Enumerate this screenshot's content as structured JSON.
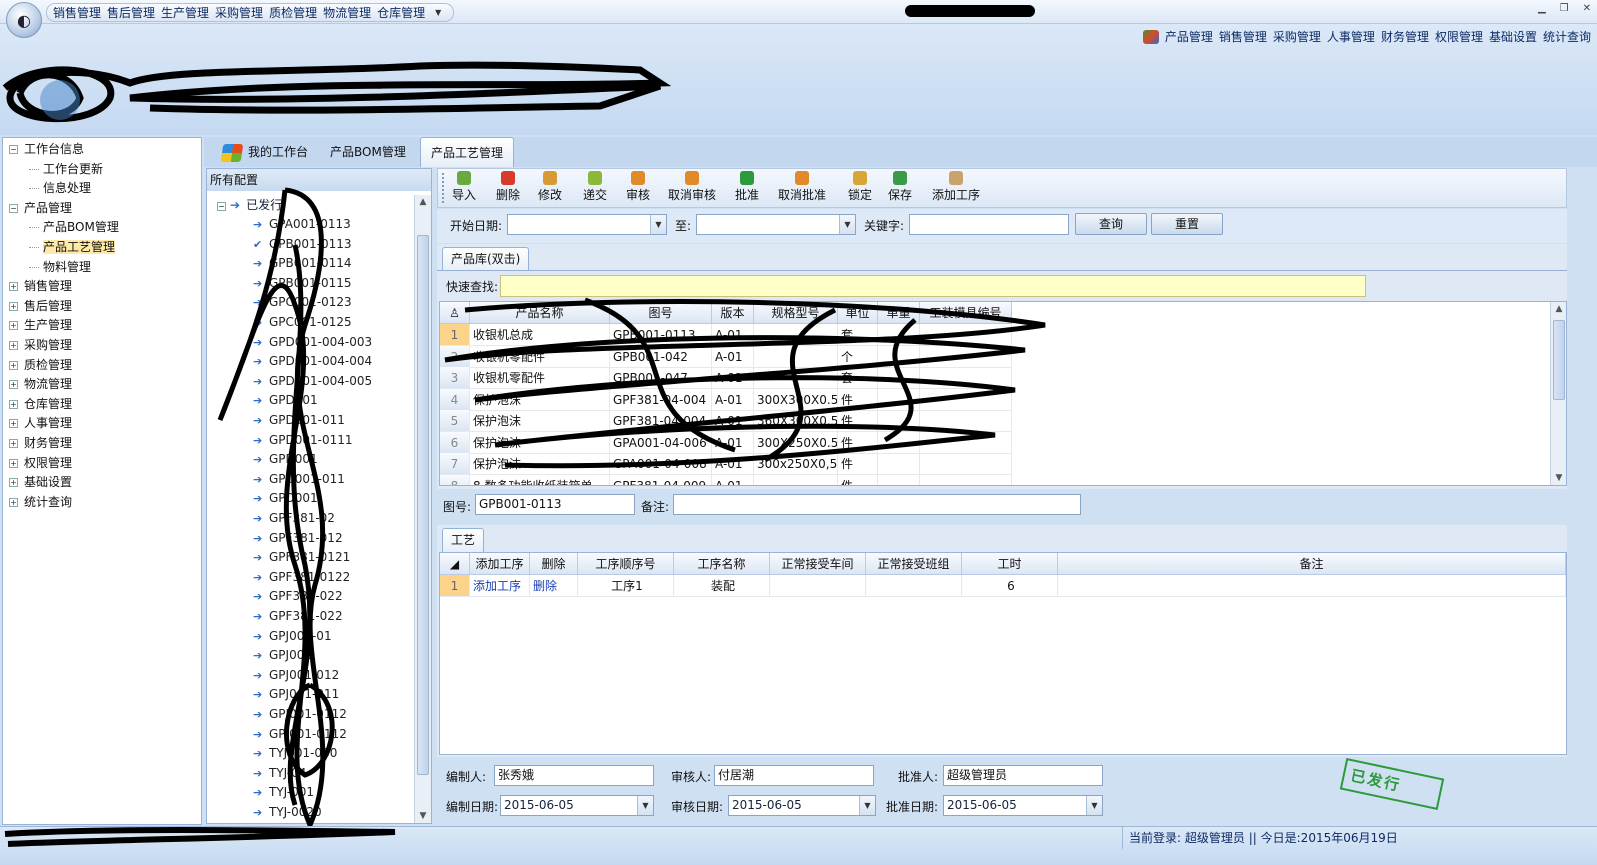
{
  "quick_menu": [
    "销售管理",
    "售后管理",
    "生产管理",
    "采购管理",
    "质检管理",
    "物流管理",
    "仓库管理"
  ],
  "top_nav": [
    "产品管理",
    "销售管理",
    "采购管理",
    "人事管理",
    "财务管理",
    "权限管理",
    "基础设置",
    "统计查询"
  ],
  "left_tree": {
    "items": [
      {
        "label": "工作台信息",
        "toggle": "−",
        "level": 0
      },
      {
        "label": "工作台更新",
        "level": 1
      },
      {
        "label": "信息处理",
        "level": 1
      },
      {
        "label": "产品管理",
        "toggle": "−",
        "level": 0
      },
      {
        "label": "产品BOM管理",
        "level": 1
      },
      {
        "label": "产品工艺管理",
        "level": 1,
        "selected": true
      },
      {
        "label": "物料管理",
        "level": 1
      },
      {
        "label": "销售管理",
        "toggle": "+",
        "level": 0
      },
      {
        "label": "售后管理",
        "toggle": "+",
        "level": 0
      },
      {
        "label": "生产管理",
        "toggle": "+",
        "level": 0
      },
      {
        "label": "采购管理",
        "toggle": "+",
        "level": 0
      },
      {
        "label": "质检管理",
        "toggle": "+",
        "level": 0
      },
      {
        "label": "物流管理",
        "toggle": "+",
        "level": 0
      },
      {
        "label": "仓库管理",
        "toggle": "+",
        "level": 0
      },
      {
        "label": "人事管理",
        "toggle": "+",
        "level": 0
      },
      {
        "label": "财务管理",
        "toggle": "+",
        "level": 0
      },
      {
        "label": "权限管理",
        "toggle": "+",
        "level": 0
      },
      {
        "label": "基础设置",
        "toggle": "+",
        "level": 0
      },
      {
        "label": "统计查询",
        "toggle": "+",
        "level": 0
      }
    ]
  },
  "tabs": [
    {
      "label": "我的工作台"
    },
    {
      "label": "产品BOM管理"
    },
    {
      "label": "产品工艺管理",
      "active": true
    }
  ],
  "config_panel": {
    "header": "所有配置",
    "root_label": "已发行",
    "items": [
      "GPA001-0113",
      "GPB001-0113",
      "GPB001-0114",
      "GPB001-0115",
      "GPC001-0123",
      "GPC001-0125",
      "GPD001-004-003",
      "GPD001-004-004",
      "GPD001-004-005",
      "GPD001",
      "GPD001-011",
      "GPD001-0111",
      "GPD001",
      "GPD001-011",
      "GPD001",
      "GPF381-02",
      "GPF381-012",
      "GPF381-0121",
      "GPF381-0122",
      "GPF381-022",
      "GPF381-022",
      "GPJ001-01",
      "GPJ001",
      "GPJ001-012",
      "GPJ001-011",
      "GPJ001-0112",
      "GPJ001-0112",
      "TYJ001-030",
      "TYJ-04",
      "TYJ-001",
      "TYJ-0020"
    ]
  },
  "toolbar": [
    {
      "label": "导入",
      "icon": "import-icon",
      "color": "#6aa840"
    },
    {
      "label": "删除",
      "icon": "delete-icon",
      "color": "#d83a2b"
    },
    {
      "label": "修改",
      "icon": "edit-icon",
      "color": "#d89a36"
    },
    {
      "label": "递交",
      "icon": "submit-icon",
      "color": "#8cb83a"
    },
    {
      "label": "审核",
      "icon": "audit-icon",
      "color": "#e08a2a"
    },
    {
      "label": "取消审核",
      "icon": "cancel-audit-icon",
      "color": "#e08a2a"
    },
    {
      "label": "批准",
      "icon": "approve-icon",
      "color": "#2a9a3a"
    },
    {
      "label": "取消批准",
      "icon": "cancel-approve-icon",
      "color": "#e08a2a"
    },
    {
      "label": "锁定",
      "icon": "lock-icon",
      "color": "#d8a536"
    },
    {
      "label": "保存",
      "icon": "save-icon",
      "color": "#3a9a4a"
    },
    {
      "label": "添加工序",
      "icon": "add-process-icon",
      "color": "#c9a46a"
    }
  ],
  "search": {
    "start_label": "开始日期:",
    "start_value": "",
    "to_label": "至:",
    "end_value": "",
    "keyword_label": "关键字:",
    "keyword_value": "",
    "query_btn": "查询",
    "reset_btn": "重置"
  },
  "product_panel": {
    "tab": "产品库(双击)",
    "quick_search_label": "快速查找:",
    "quick_search_value": "",
    "columns": [
      "产品名称",
      "图号",
      "版本",
      "规格型号",
      "单位",
      "单重",
      "工装模具编号"
    ],
    "rows": [
      {
        "n": "1",
        "name": "收银机总成",
        "code": "GPB001-0113",
        "ver": "A-01",
        "spec": "",
        "unit": "套",
        "weight": "",
        "mold": ""
      },
      {
        "n": "2",
        "name": "收银机零配件",
        "code": "GPB001-042",
        "ver": "A-01",
        "spec": "",
        "unit": "个",
        "weight": "",
        "mold": ""
      },
      {
        "n": "3",
        "name": "收银机零配件",
        "code": "GPB001-047",
        "ver": "A-01",
        "spec": "",
        "unit": "套",
        "weight": "",
        "mold": ""
      },
      {
        "n": "4",
        "name": "保护泡沫",
        "code": "GPF381-04-004",
        "ver": "A-01",
        "spec": "300X300X0.5",
        "unit": "件",
        "weight": "",
        "mold": ""
      },
      {
        "n": "5",
        "name": "保护泡沫",
        "code": "GPF381-04-004",
        "ver": "A-01",
        "spec": "360X300X0.5",
        "unit": "件",
        "weight": "",
        "mold": ""
      },
      {
        "n": "6",
        "name": "保护泡沫",
        "code": "GPA001-04-006",
        "ver": "A-01",
        "spec": "300X250X0.5",
        "unit": "件",
        "weight": "",
        "mold": ""
      },
      {
        "n": "7",
        "name": "保护泡沫",
        "code": "GPA001-04-008",
        "ver": "A-01",
        "spec": "300x250X0,5",
        "unit": "件",
        "weight": "",
        "mold": ""
      },
      {
        "n": "8",
        "name": "8.数多功能收纸装箱单",
        "code": "GPF381-04-009",
        "ver": "A-01",
        "spec": "",
        "unit": "件",
        "weight": "",
        "mold": ""
      }
    ]
  },
  "detail": {
    "code_label": "图号:",
    "code_value": "GPB001-0113",
    "remark_label": "备注:",
    "remark_value": ""
  },
  "process_panel": {
    "tab": "工艺",
    "columns": [
      "添加工序",
      "删除",
      "工序顺序号",
      "工序名称",
      "正常接受车间",
      "正常接受班组",
      "工时",
      "备注"
    ],
    "rows": [
      {
        "n": "1",
        "add": "添加工序",
        "del": "删除",
        "seq": "工序1",
        "name": "装配",
        "workshop": "",
        "team": "",
        "hours": "6",
        "remark": ""
      }
    ]
  },
  "form": {
    "editor_label": "编制人:",
    "editor_value": "张秀娥",
    "reviewer_label": "审核人:",
    "reviewer_value": "付居潮",
    "approver_label": "批准人:",
    "approver_value": "超级管理员",
    "edit_date_label": "编制日期:",
    "edit_date_value": "2015-06-05",
    "review_date_label": "审核日期:",
    "review_date_value": "2015-06-05",
    "approve_date_label": "批准日期:",
    "approve_date_value": "2015-06-05"
  },
  "stamp": "已发行",
  "status": {
    "login_label": "当前登录:",
    "login_user": "超级管理员",
    "separator": "||",
    "today": "今日是:2015年06月19日"
  },
  "colors": {
    "accent": "#1b3fb5",
    "selected_row": "#fbd38a",
    "quick_search_bg": "#ffffc8",
    "stamp": "#2c9a3a"
  }
}
